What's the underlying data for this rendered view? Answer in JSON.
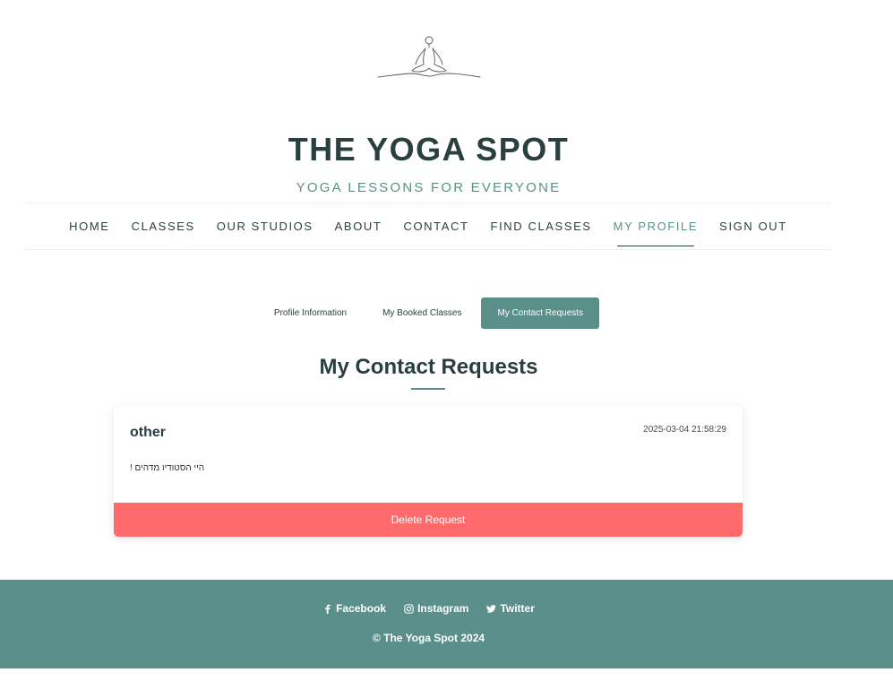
{
  "site": {
    "title": "THE YOGA SPOT",
    "subtitle": "YOGA LESSONS FOR EVERYONE"
  },
  "nav": {
    "items": [
      {
        "label": "HOME"
      },
      {
        "label": "CLASSES"
      },
      {
        "label": "OUR STUDIOS"
      },
      {
        "label": "ABOUT"
      },
      {
        "label": "CONTACT"
      },
      {
        "label": "FIND CLASSES"
      },
      {
        "label": "MY PROFILE",
        "active": true
      },
      {
        "label": "SIGN OUT"
      }
    ]
  },
  "profile_tabs": [
    {
      "label": "Profile Information"
    },
    {
      "label": "My Booked Classes"
    },
    {
      "label": "My Contact Requests",
      "active": true
    }
  ],
  "section": {
    "title": "My Contact Requests"
  },
  "requests": [
    {
      "subject": "other",
      "date": "2025-03-04 21:58:29",
      "message": "היי הסטודיו מדהים !",
      "delete_label": "Delete Request"
    }
  ],
  "footer": {
    "social": [
      {
        "label": "Facebook",
        "icon": "facebook-icon"
      },
      {
        "label": "Instagram",
        "icon": "instagram-icon"
      },
      {
        "label": "Twitter",
        "icon": "twitter-icon"
      }
    ],
    "copyright": "© The Yoga Spot 2024"
  },
  "colors": {
    "accent": "#5b8f89",
    "title": "#2a3f3f",
    "delete": "#ff6b6b"
  }
}
